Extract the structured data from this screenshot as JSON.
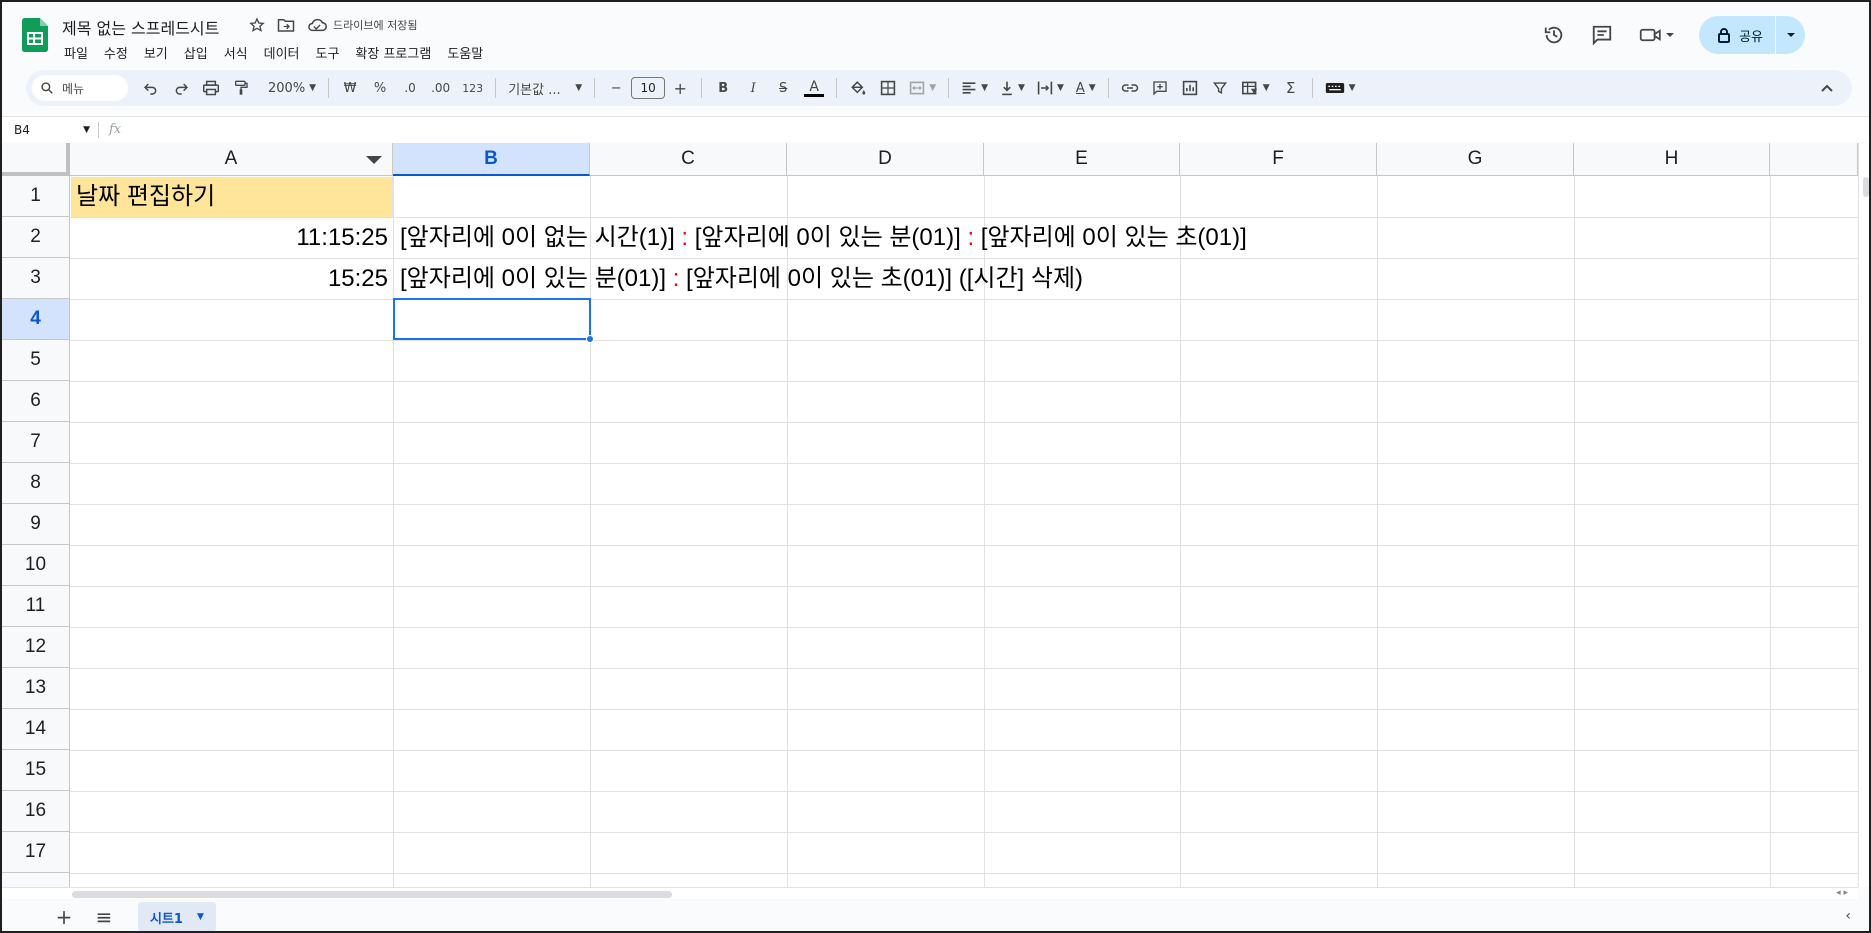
{
  "app": {
    "doc_title": "제목 없는 스프레드시트",
    "saved_status": "드라이브에 저장됨",
    "menu": [
      "파일",
      "수정",
      "보기",
      "삽입",
      "서식",
      "데이터",
      "도구",
      "확장 프로그램",
      "도움말"
    ],
    "share_label": "공유",
    "brand_color": "#0f9d58"
  },
  "toolbar": {
    "search_label": "메뉴",
    "zoom": "200%",
    "currency": "₩",
    "percent": "%",
    "dec_decrease": ".0",
    "dec_increase": ".00",
    "number_format": "123",
    "font_name": "기본값 ...",
    "minus": "−",
    "font_size": "10",
    "plus": "+",
    "bold": "B",
    "italic": "I",
    "strike": "S",
    "text_color": "A",
    "rotate": "A",
    "sum": "Σ"
  },
  "formula_bar": {
    "cell_ref": "B4",
    "fx": "fx"
  },
  "grid": {
    "columns": [
      "A",
      "B",
      "C",
      "D",
      "E",
      "F",
      "G",
      "H"
    ],
    "rows": [
      "1",
      "2",
      "3",
      "4",
      "5",
      "6",
      "7",
      "8",
      "9",
      "10",
      "11",
      "12",
      "13",
      "14",
      "15",
      "16",
      "17"
    ],
    "selected_cell": "B4",
    "a1_fill": "#ffe599",
    "cells": {
      "A1": "날짜 편집하기",
      "A2": "11:15:25",
      "A3": "15:25",
      "B2_part1": "[앞자리에 0이 없는 시간(1)] ",
      "B2_sep1": ":",
      "B2_part2": " [앞자리에 0이 있는 분(01)] ",
      "B2_sep2": ":",
      "B2_part3": " [앞자리에 0이 있는 초(01)]",
      "B3_part1": "[앞자리에 0이 있는 분(01)] ",
      "B3_sep1": ":",
      "B3_part2": " [앞자리에 0이 있는 초(01)] ([시간] 삭제)"
    }
  },
  "sheets": {
    "add": "+",
    "list": "≡",
    "tabs": [
      {
        "label": "시트1"
      }
    ]
  }
}
